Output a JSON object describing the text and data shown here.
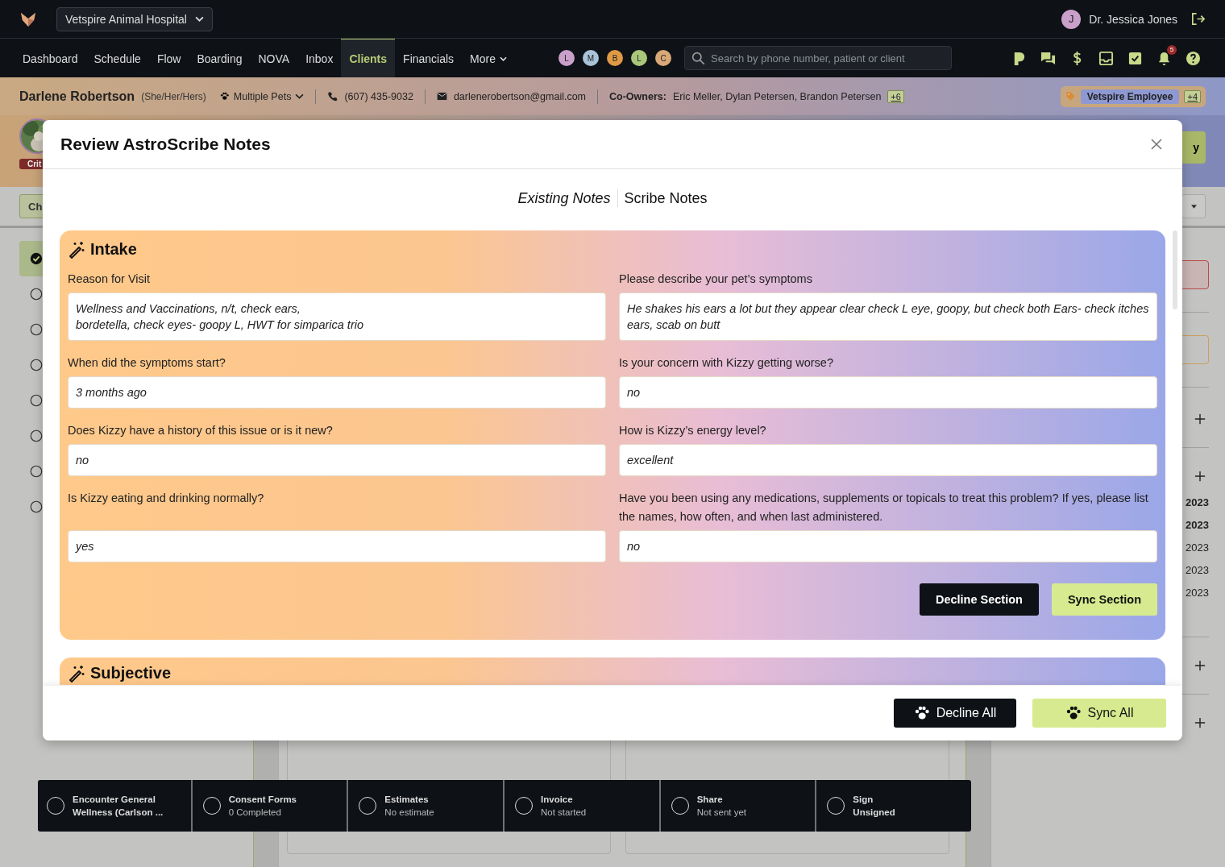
{
  "clinic_selector": {
    "label": "Vetspire Animal Hospital"
  },
  "user": {
    "initial": "J",
    "name": "Dr. Jessica Jones"
  },
  "nav": [
    {
      "label": "Dashboard",
      "selected": false
    },
    {
      "label": "Schedule",
      "selected": false
    },
    {
      "label": "Flow",
      "selected": false
    },
    {
      "label": "Boarding",
      "selected": false
    },
    {
      "label": "NOVA",
      "selected": false
    },
    {
      "label": "Inbox",
      "selected": false
    },
    {
      "label": "Clients",
      "selected": true
    },
    {
      "label": "Financials",
      "selected": false
    },
    {
      "label": "More",
      "selected": false
    }
  ],
  "staff_avatars": [
    {
      "initial": "L",
      "color": "#c9a0c9"
    },
    {
      "initial": "M",
      "color": "#a9c4d8"
    },
    {
      "initial": "B",
      "color": "#e09a45"
    },
    {
      "initial": "L",
      "color": "#a9c77a"
    },
    {
      "initial": "C",
      "color": "#d9a877"
    }
  ],
  "search": {
    "placeholder": "Search by phone number, patient or client"
  },
  "notifications": {
    "count": "5"
  },
  "client": {
    "name": "Darlene Robertson",
    "pronouns": "(She/Her/Hers)",
    "pets": "Multiple Pets",
    "phone": "(607) 435-9032",
    "email": "darlenerobertson@gmail.com",
    "co_owners_label": "Co-Owners:",
    "co_owners": "Eric Meller,  Dylan Petersen, Brandon Petersen",
    "co_owners_more": "+6",
    "tag": "Vetspire Employee",
    "tags_more": "+4"
  },
  "background": {
    "alert_badge": "Crit",
    "left_button": "Ch",
    "right_button": "y",
    "checklist": [
      {
        "done": true
      },
      {
        "done": false
      },
      {
        "done": false
      },
      {
        "done": false
      },
      {
        "done": false
      },
      {
        "done": false
      },
      {
        "done": false
      },
      {
        "done": false
      }
    ],
    "dates": [
      {
        "text": "2023",
        "bold": true
      },
      {
        "text": "2023",
        "bold": true
      },
      {
        "text": "2023",
        "bold": false
      },
      {
        "text": "2023",
        "bold": false
      },
      {
        "text": "2023",
        "bold": false
      }
    ]
  },
  "modal": {
    "title": "Review AstroScribe Notes",
    "tabs": [
      {
        "label": "Existing Notes",
        "selected": false
      },
      {
        "label": "Scribe Notes",
        "selected": true
      }
    ],
    "sections": [
      {
        "title": "Intake",
        "fields": [
          {
            "label": "Reason for Visit",
            "value": "Wellness and Vaccinations, n/t, check ears,\nbordetella, check eyes- goopy L, HWT for simparica trio"
          },
          {
            "label": "Please describe your pet’s symptoms",
            "value": "He shakes his ears a lot but they appear clear check L eye, goopy, but check both Ears- check itches ears, scab on butt"
          },
          {
            "label": "When did the symptoms start?",
            "value": "3 months ago"
          },
          {
            "label": "Is your concern with Kizzy getting worse?",
            "value": "no"
          },
          {
            "label": "Does Kizzy have a history of this issue or is it new?",
            "value": "no"
          },
          {
            "label": "How is Kizzy’s energy level?",
            "value": "excellent"
          },
          {
            "label": "Is Kizzy eating and drinking normally?",
            "value": "yes"
          },
          {
            "label": "Have you been using any medications, supplements or topicals to treat this problem? If yes, please list the names, how often, and when last administered.",
            "value": "no"
          }
        ],
        "buttons": [
          "Decline Section",
          "Sync Section"
        ]
      },
      {
        "title": "Subjective"
      }
    ],
    "footer_buttons": [
      "Decline All",
      "Sync All"
    ]
  },
  "steps": [
    {
      "title": "Encounter General",
      "subtitle": "Wellness (Carlson ..."
    },
    {
      "title": "Consent Forms",
      "subtitle": "0 Completed"
    },
    {
      "title": "Estimates",
      "subtitle": "No estimate"
    },
    {
      "title": "Invoice",
      "subtitle": "Not started"
    },
    {
      "title": "Share",
      "subtitle": "Not sent yet"
    },
    {
      "title": "Sign",
      "subtitle": "Unsigned"
    }
  ]
}
